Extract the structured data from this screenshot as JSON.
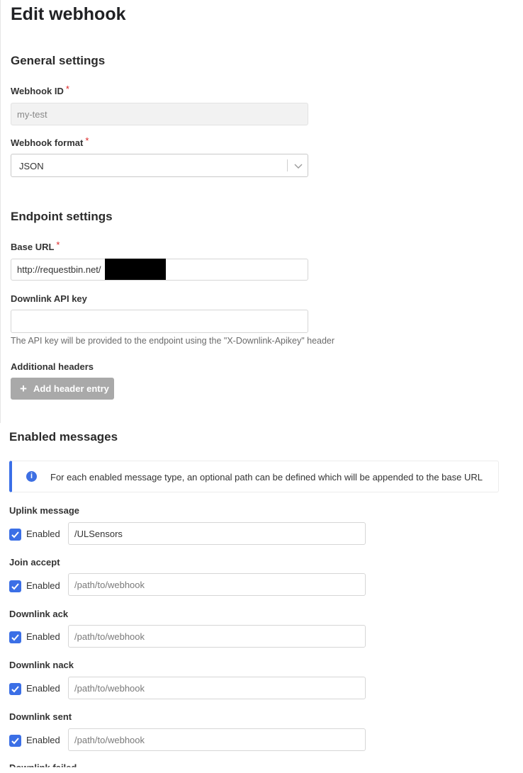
{
  "page": {
    "title": "Edit webhook"
  },
  "general": {
    "title": "General settings",
    "webhook_id": {
      "label": "Webhook ID",
      "required": "*",
      "value": "my-test"
    },
    "webhook_format": {
      "label": "Webhook format",
      "required": "*",
      "value": "JSON",
      "icon": "chevron-down-icon"
    }
  },
  "endpoint": {
    "title": "Endpoint settings",
    "base_url": {
      "label": "Base URL",
      "required": "*",
      "value": "http://requestbin.net/"
    },
    "downlink_api_key": {
      "label": "Downlink API key",
      "value": "",
      "help": "The API key will be provided to the endpoint using the \"X-Downlink-Apikey\" header"
    },
    "additional_headers": {
      "label": "Additional headers",
      "add_button": "Add header entry",
      "icon": "plus-icon"
    }
  },
  "messages": {
    "title": "Enabled messages",
    "info": "For each enabled message type, an optional path can be defined which will be appended to the base URL",
    "info_icon": "info-icon",
    "accent": "#3b6fe6",
    "items": [
      {
        "label": "Uplink message",
        "checkbox_label": "Enabled",
        "checked": true,
        "value": "/ULSensors",
        "placeholder": "/path/to/webhook"
      },
      {
        "label": "Join accept",
        "checkbox_label": "Enabled",
        "checked": true,
        "value": "",
        "placeholder": "/path/to/webhook"
      },
      {
        "label": "Downlink ack",
        "checkbox_label": "Enabled",
        "checked": true,
        "value": "",
        "placeholder": "/path/to/webhook"
      },
      {
        "label": "Downlink nack",
        "checkbox_label": "Enabled",
        "checked": true,
        "value": "",
        "placeholder": "/path/to/webhook"
      },
      {
        "label": "Downlink sent",
        "checkbox_label": "Enabled",
        "checked": true,
        "value": "",
        "placeholder": "/path/to/webhook"
      },
      {
        "label": "Downlink failed"
      }
    ]
  }
}
